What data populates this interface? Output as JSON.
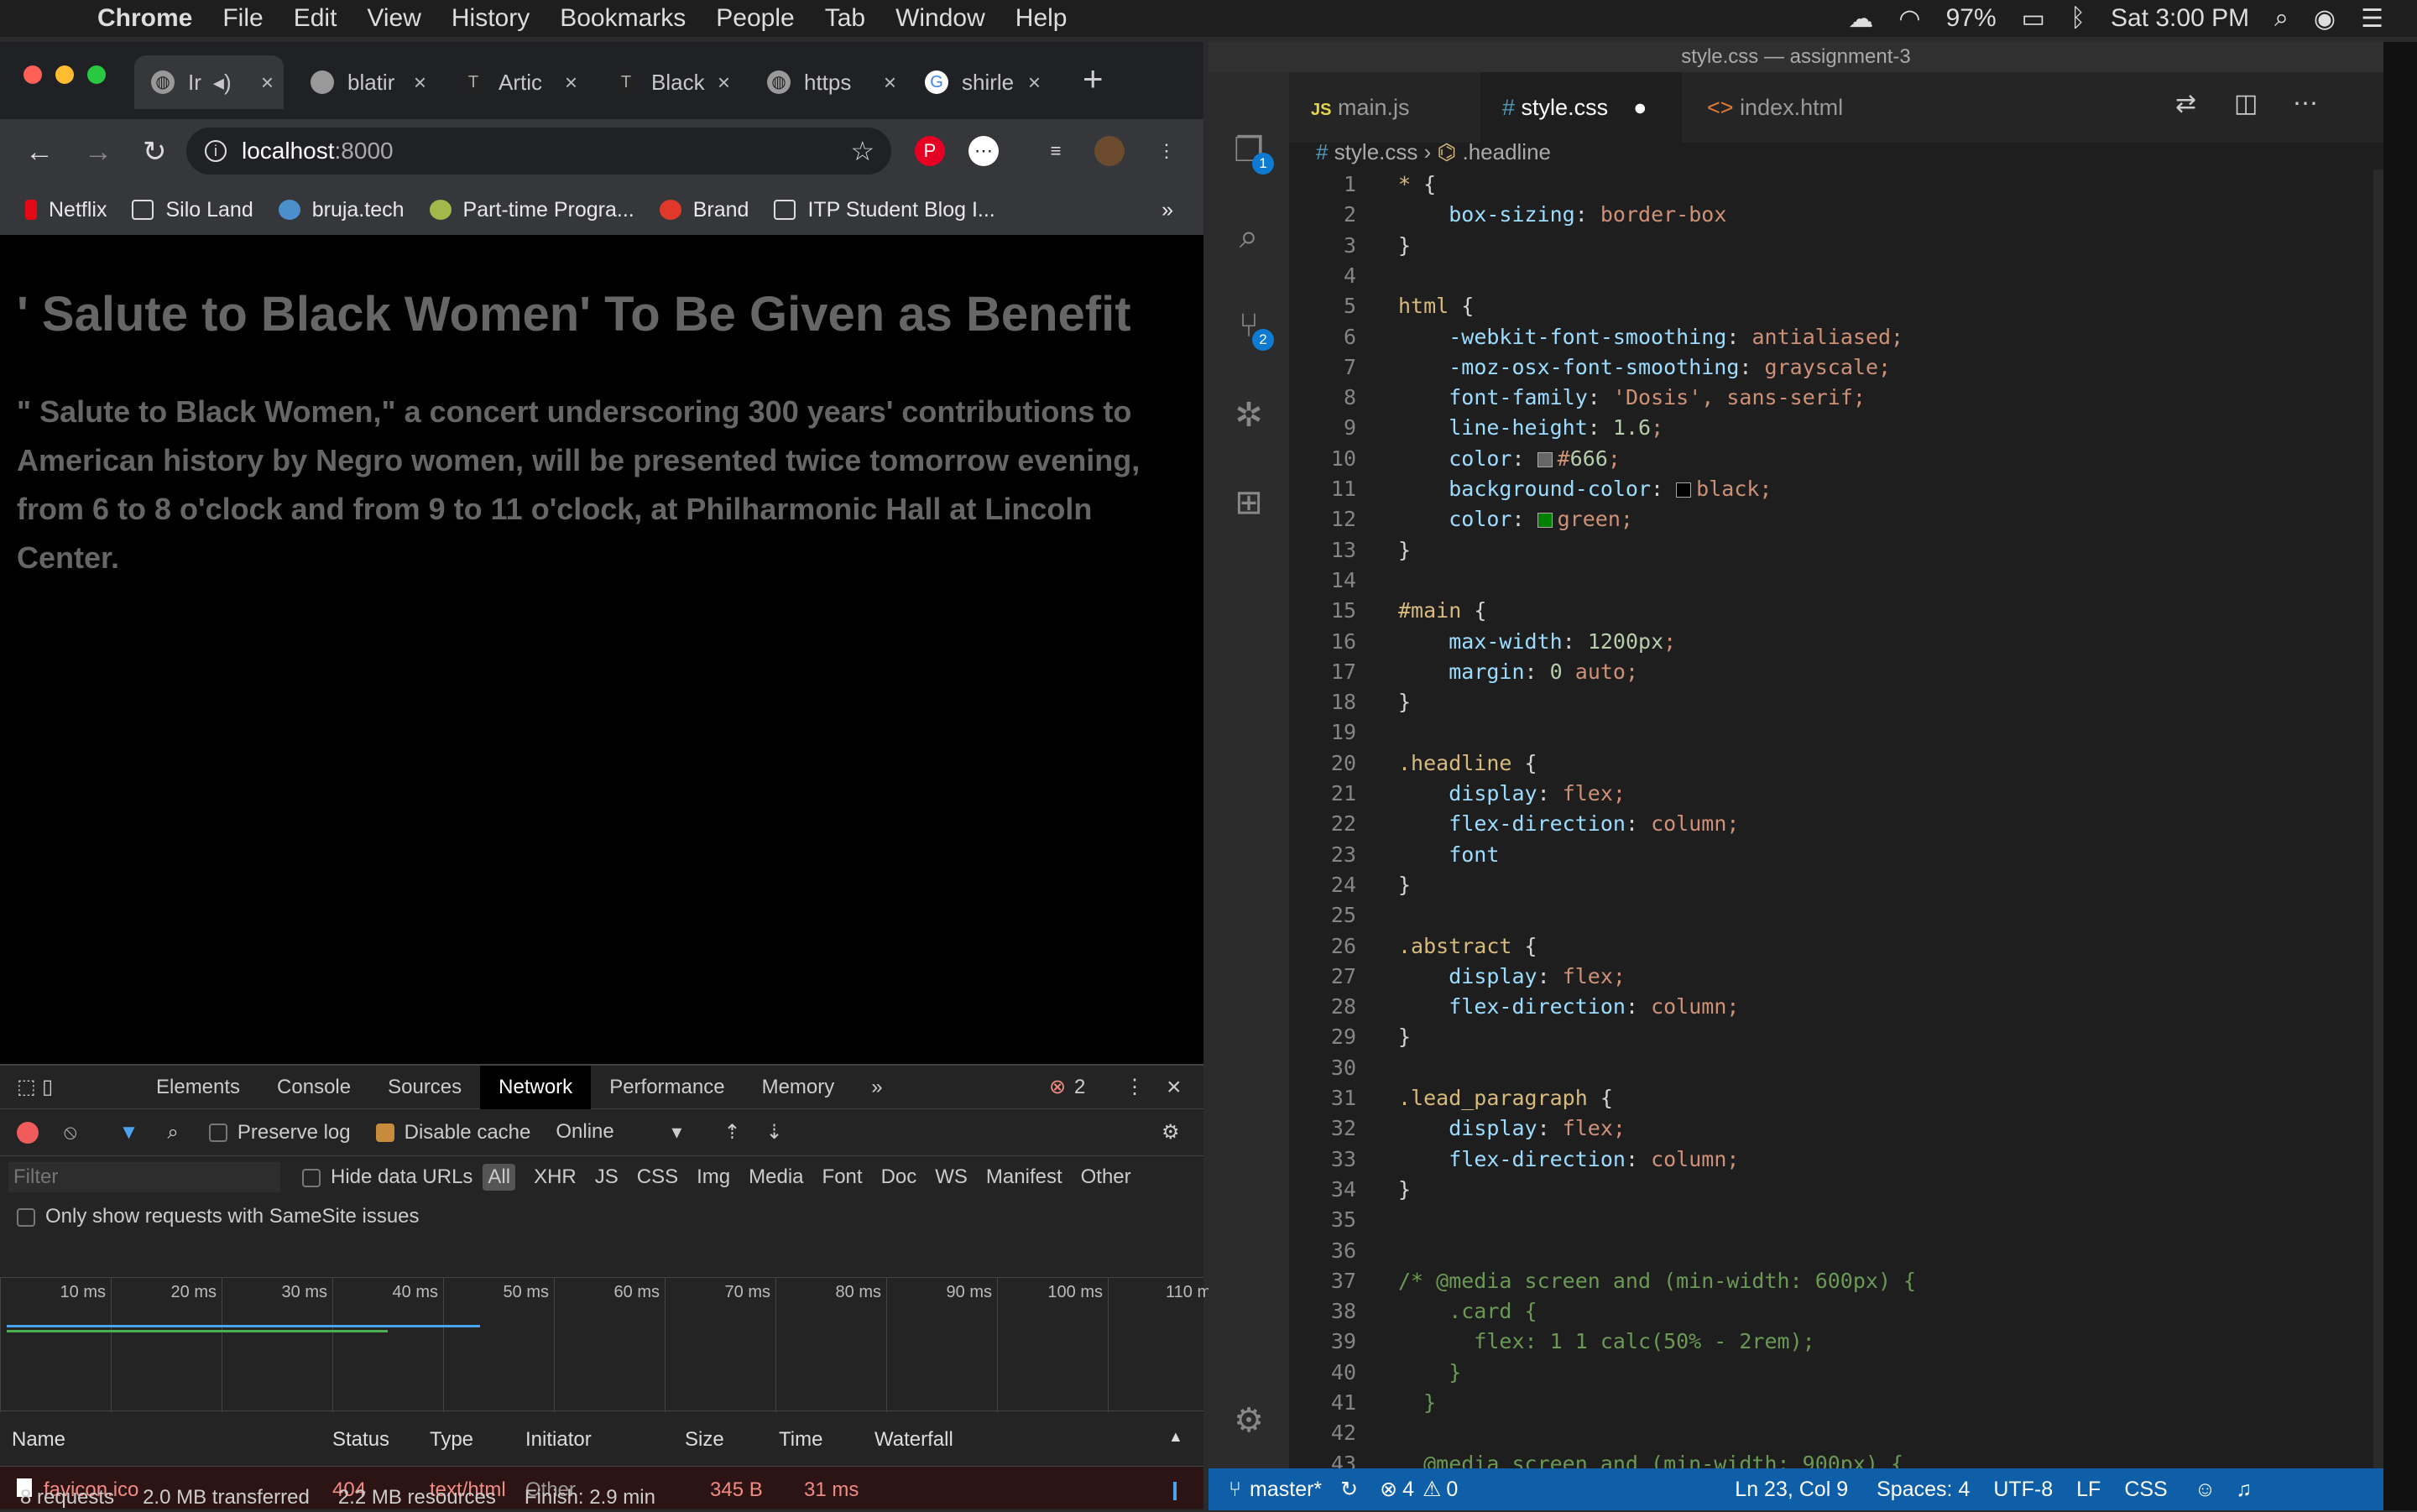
{
  "menubar": {
    "app": "Chrome",
    "items": [
      "File",
      "Edit",
      "View",
      "History",
      "Bookmarks",
      "People",
      "Tab",
      "Window",
      "Help"
    ],
    "battery": "97%",
    "clock": "Sat 3:00 PM"
  },
  "chrome": {
    "tabs": [
      {
        "title": "Ir",
        "active": true
      },
      {
        "title": "blatir"
      },
      {
        "title": "Artic"
      },
      {
        "title": "Black"
      },
      {
        "title": "https"
      },
      {
        "title": "shirle"
      }
    ],
    "url_host": "localhost",
    "url_port": ":8000",
    "bookmarks": [
      "Netflix",
      "Silo Land",
      "bruja.tech",
      "Part-time Progra...",
      "Brand",
      "ITP Student Blog I..."
    ],
    "bookmarks_more": "»"
  },
  "article": {
    "headline": "' Salute to Black Women' To Be Given as Benefit",
    "abstract": "\" Salute to Black Women,\" a concert underscoring 300 years' contributions to American history by Negro women, will be presented twice tomorrow evening, from 6 to 8 o'clock and from 9 to 11 o'clock, at Philharmonic Hall at Lincoln Center."
  },
  "devtools": {
    "tabs": [
      "Elements",
      "Console",
      "Sources",
      "Network",
      "Performance",
      "Memory"
    ],
    "active_tab": "Network",
    "more": "»",
    "errors": "2",
    "preserve_log": "Preserve log",
    "disable_cache": "Disable cache",
    "throttle": "Online",
    "filter_placeholder": "Filter",
    "hide_data_urls": "Hide data URLs",
    "types": [
      "All",
      "XHR",
      "JS",
      "CSS",
      "Img",
      "Media",
      "Font",
      "Doc",
      "WS",
      "Manifest",
      "Other"
    ],
    "samesite": "Only show requests with SameSite issues",
    "ticks": [
      "10 ms",
      "20 ms",
      "30 ms",
      "40 ms",
      "50 ms",
      "60 ms",
      "70 ms",
      "80 ms",
      "90 ms",
      "100 ms",
      "110 ms"
    ],
    "columns": [
      "Name",
      "Status",
      "Type",
      "Initiator",
      "Size",
      "Time",
      "Waterfall"
    ],
    "rows": [
      {
        "name": "favicon.ico",
        "status": "404",
        "type": "text/html",
        "initiator": "Other",
        "size": "345 B",
        "time": "31 ms"
      }
    ],
    "summary": {
      "requests": "8 requests",
      "transferred": "2.0 MB transferred",
      "resources": "2.2 MB resources",
      "finish": "Finish: 2.9 min"
    }
  },
  "vscode": {
    "title": "style.css — assignment-3",
    "tabs": [
      "main.js",
      "style.css",
      "index.html"
    ],
    "active_tab": "style.css",
    "breadcrumb_file": "style.css",
    "breadcrumb_symbol": ".headline",
    "activity_badges": {
      "explorer": "1",
      "scm": "2"
    },
    "status": {
      "branch": "master*",
      "errors": "4",
      "warnings": "0",
      "position": "Ln 23, Col 9",
      "spaces": "Spaces: 4",
      "encoding": "UTF-8",
      "eol": "LF",
      "language": "CSS"
    },
    "colors": {
      "gray": "#666",
      "black": "#000000",
      "green": "#008000"
    }
  },
  "code_lines": [
    "* {",
    "    box-sizing: border-box",
    "}",
    "",
    "html {",
    "    -webkit-font-smoothing: antialiased;",
    "    -moz-osx-font-smoothing: grayscale;",
    "    font-family: 'Dosis', sans-serif;",
    "    line-height: 1.6;",
    "    color: #666;",
    "    background-color: black;",
    "    color: green;",
    "}",
    "",
    "#main {",
    "    max-width: 1200px;",
    "    margin: 0 auto;",
    "}",
    "",
    ".headline {",
    "    display: flex;",
    "    flex-direction: column;",
    "    font",
    "}",
    "",
    ".abstract {",
    "    display: flex;",
    "    flex-direction: column;",
    "}",
    "",
    ".lead_paragraph {",
    "    display: flex;",
    "    flex-direction: column;",
    "}",
    "",
    "",
    "/* @media screen and (min-width: 600px) {",
    "    .card {",
    "      flex: 1 1 calc(50% - 2rem);",
    "    }",
    "  }",
    "",
    "  @media screen and (min-width: 900px) {"
  ]
}
